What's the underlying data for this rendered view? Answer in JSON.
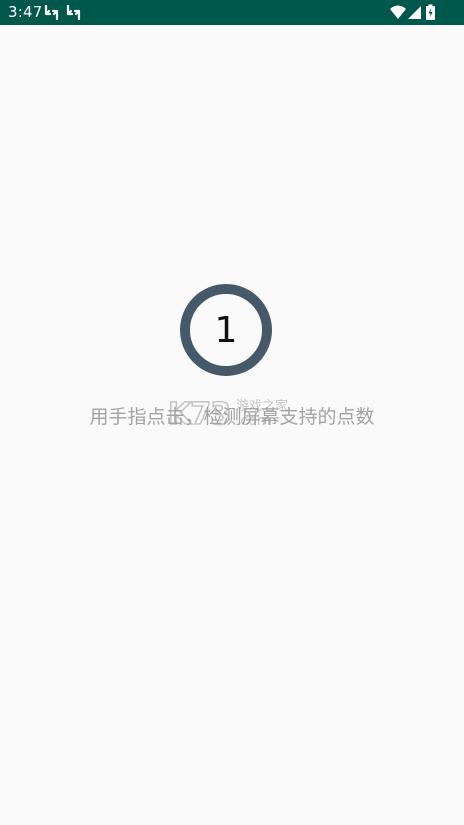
{
  "status_bar": {
    "time": "3:47",
    "left_icons": [
      "sync-icon",
      "sync-icon"
    ],
    "right_icons": [
      "wifi-icon",
      "cellular-signal-icon",
      "battery-charging-icon"
    ],
    "background_color": "#00574b"
  },
  "main": {
    "touch_count": "1",
    "instruction_text": "用手指点击，检测屏幕支持的点数",
    "ring_color": "#465968"
  },
  "watermark": {
    "brand": "K73",
    "tagline": "游戏之家",
    "domain": ".com"
  }
}
